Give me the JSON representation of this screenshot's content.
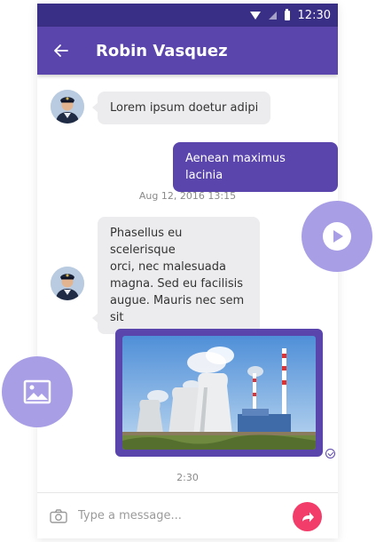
{
  "status_bar": {
    "time": "12:30",
    "icons": [
      "wifi-icon",
      "cell-signal-icon",
      "battery-icon"
    ]
  },
  "header": {
    "title": "Robin Vasquez",
    "back_icon": "arrow-left-icon"
  },
  "messages": [
    {
      "direction": "incoming",
      "text": "Lorem ipsum doetur adipi"
    },
    {
      "direction": "outgoing",
      "text": "Aenean maximus lacinia"
    },
    {
      "type": "timestamp",
      "text": "Aug 12, 2016 13:15"
    },
    {
      "direction": "incoming",
      "lines": [
        "Phasellus eu scelerisque",
        "orci, nec malesuada",
        "magna. Sed eu facilisis",
        "augue. Mauris nec sem sit"
      ]
    },
    {
      "direction": "outgoing",
      "type": "image",
      "image": "power-plant-cooling-towers",
      "status_icon": "check-circle-icon"
    },
    {
      "type": "timestamp",
      "text": "2:30"
    }
  ],
  "composer": {
    "placeholder": "Type a message...",
    "camera_icon": "camera-icon",
    "send_icon": "send-icon"
  },
  "floating": {
    "play_icon": "play-icon",
    "image_icon": "image-icon"
  },
  "colors": {
    "primary": "#5a45ad",
    "status_bar": "#3a2f86",
    "accent": "#f23d6a",
    "fab": "#a89ee6",
    "bubble_in": "#ececee"
  }
}
